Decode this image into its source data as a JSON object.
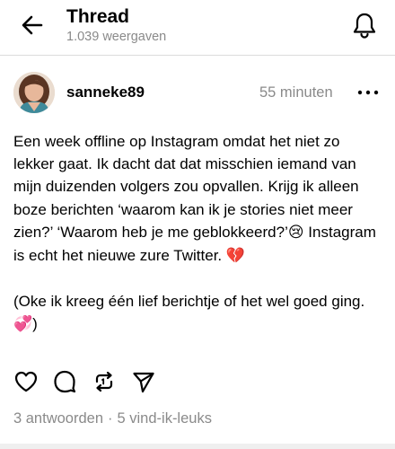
{
  "header": {
    "title": "Thread",
    "views": "1.039 weergaven",
    "back_icon": "arrow-left-icon",
    "notifications_icon": "bell-icon"
  },
  "post": {
    "username": "sanneke89",
    "timestamp": "55 minuten",
    "more_icon": "more-horizontal-icon",
    "text_line1": "Een week offline op Instagram omdat het niet zo lekker gaat. Ik dacht dat dat misschien iemand van mijn duizenden volgers zou opvallen. Krijg ik alleen boze berichten ‘waarom kan ik je stories niet meer zien?’ ‘Waarom heb je me geblokkeerd?’",
    "emoji_crying": "😢",
    "text_line2": " Instagram is echt het nieuwe zure Twitter. ",
    "emoji_broken_heart": "💔",
    "text_para2": "(Oke ik kreeg één lief berichtje of het wel goed ging. ",
    "emoji_hearts": "💞",
    "text_para2_end": ")"
  },
  "actions": {
    "like_icon": "heart-icon",
    "reply_icon": "comment-icon",
    "repost_icon": "repost-icon",
    "share_icon": "send-icon"
  },
  "stats": {
    "replies": "3 antwoorden",
    "separator": "·",
    "likes": "5 vind-ik-leuks"
  },
  "colors": {
    "text": "#000000",
    "muted": "#8a8a8a",
    "divider": "#dbdbdb",
    "background": "#ffffff"
  }
}
